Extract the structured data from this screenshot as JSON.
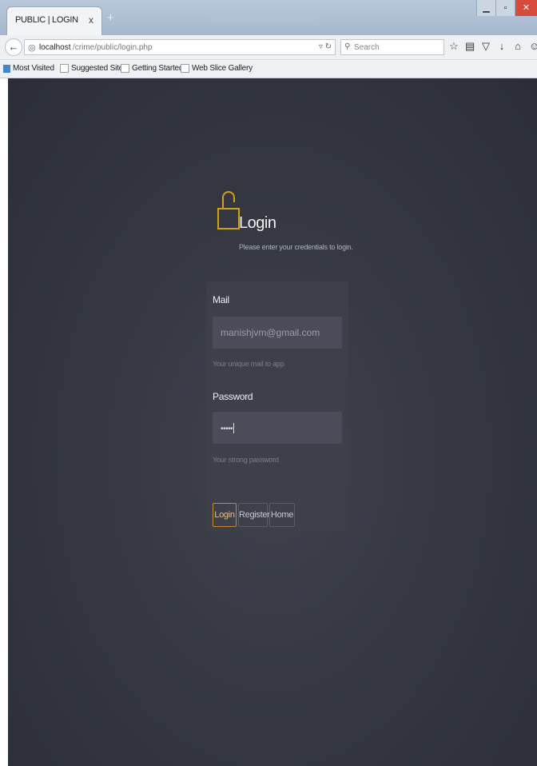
{
  "browser": {
    "tab_title": "PUBLIC | LOGIN",
    "tab_close": "x",
    "new_tab": "+",
    "url_host": "localhost",
    "url_path": "/crime/public/login.php",
    "search_placeholder": "Search",
    "bookmarks": [
      "Most Visited",
      "Suggested Sites",
      "Getting Started",
      "Web Slice Gallery"
    ]
  },
  "page": {
    "title": "Login",
    "subtitle": "Please enter your credentials to login.",
    "form": {
      "mail_label": "Mail",
      "mail_value": "manishjvm@gmail.com",
      "mail_help": "Your unique mail to app",
      "password_label": "Password",
      "password_value": "•••••",
      "password_help": "Your strong password",
      "buttons": {
        "login": "Login",
        "register": "Register",
        "home": "Home"
      }
    }
  },
  "colors": {
    "accent": "#d4a017",
    "background": "#33363f",
    "card": "#3d4049"
  }
}
